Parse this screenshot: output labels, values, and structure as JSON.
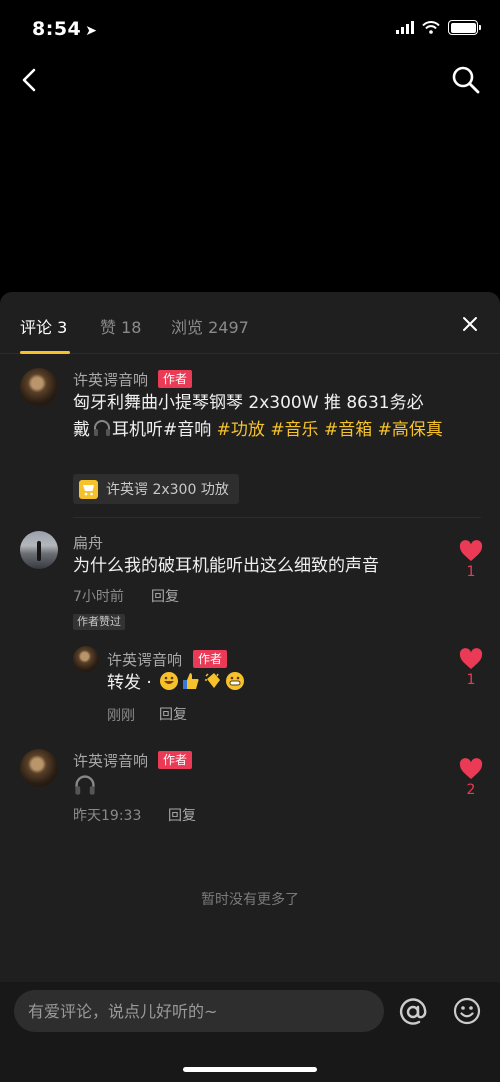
{
  "status_bar": {
    "time": "8:54"
  },
  "tabs": [
    {
      "label": "评论",
      "count": "3"
    },
    {
      "label": "赞",
      "count": "18"
    },
    {
      "label": "浏览",
      "count": "2497"
    }
  ],
  "post": {
    "author": "许英谔音响",
    "author_badge": "作者",
    "line1": "匈牙利舞曲小提琴钢琴 2x300W 推 8631务必",
    "line2_pre": "戴",
    "line2_post": "耳机听#音响 ",
    "tags": [
      "#功放",
      "#音乐",
      "#音箱",
      "#高保真"
    ],
    "product": "许英谔 2x300 功放"
  },
  "comments": [
    {
      "user": "扁舟",
      "text": "为什么我的破耳机能听出这么细致的声音",
      "time": "7小时前",
      "reply_label": "回复",
      "liked_badge": "作者赞过",
      "likes": "1",
      "reply": {
        "user": "许英谔音响",
        "badge": "作者",
        "text": "转发 · ",
        "time": "刚刚",
        "reply_label": "回复",
        "likes": "1"
      }
    },
    {
      "user": "许英谔音响",
      "badge": "作者",
      "time": "昨天19:33",
      "reply_label": "回复",
      "likes": "2"
    }
  ],
  "no_more": "暂时没有更多了",
  "input": {
    "placeholder": "有爱评论，说点儿好听的~"
  },
  "colors": {
    "accent": "#f6c22c",
    "badge": "#ea3a55",
    "sheet": "#1f1f1f"
  },
  "icons": [
    "back-icon",
    "search-icon",
    "close-icon",
    "cart-icon",
    "headphones-icon",
    "heart-icon",
    "at-icon",
    "emoji-icon"
  ]
}
